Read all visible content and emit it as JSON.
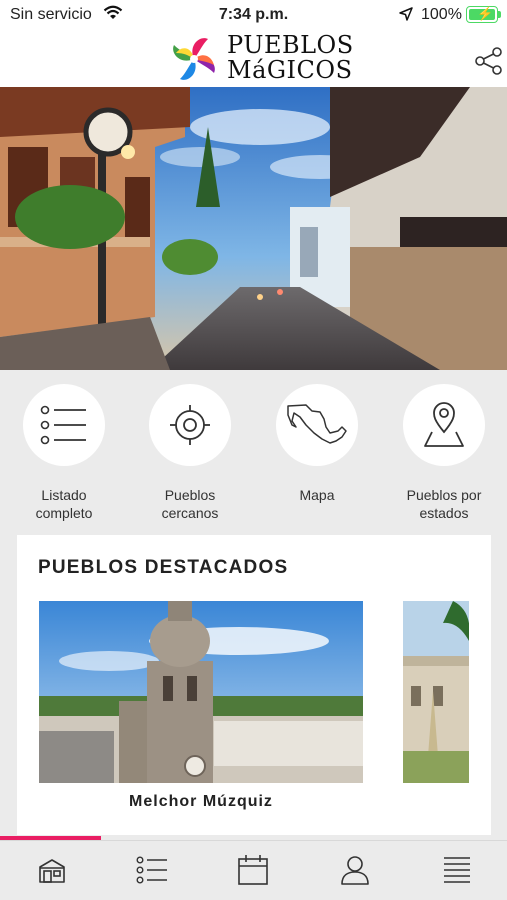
{
  "status_bar": {
    "carrier": "Sin servicio",
    "time": "7:34 p.m.",
    "battery_percent": "100%",
    "wifi_icon": "wifi-icon",
    "location_icon": "location-arrow-icon",
    "battery_icon": "battery-charging-icon"
  },
  "header": {
    "logo_line1": "PUEBLOS",
    "logo_line2": "MáGICOS",
    "share_icon": "share-icon"
  },
  "quick_actions": [
    {
      "label": "Listado\ncompleto",
      "icon": "list-icon"
    },
    {
      "label": "Pueblos\ncercanos",
      "icon": "target-icon"
    },
    {
      "label": "Mapa",
      "icon": "mexico-map-icon"
    },
    {
      "label": "Pueblos por\nestados",
      "icon": "map-pin-icon"
    }
  ],
  "featured": {
    "title": "PUEBLOS DESTACADOS",
    "items": [
      {
        "name": "Melchor Múzquiz"
      }
    ]
  },
  "progress": 0.2,
  "bottom_nav": [
    {
      "icon": "home-icon"
    },
    {
      "icon": "list-icon"
    },
    {
      "icon": "calendar-icon"
    },
    {
      "icon": "user-icon"
    },
    {
      "icon": "menu-icon"
    }
  ],
  "colors": {
    "accent": "#e91e63",
    "battery_green": "#4cd964",
    "background": "#ebebeb"
  }
}
